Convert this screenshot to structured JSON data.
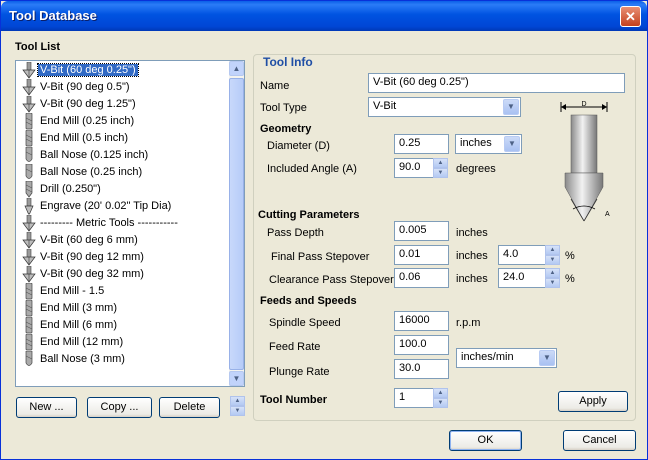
{
  "window": {
    "title": "Tool Database",
    "close_glyph": "✕"
  },
  "tool_list": {
    "label": "Tool List",
    "items": [
      {
        "label": "V-Bit (60 deg 0.25\")",
        "icon": "v-bit-icon",
        "selected": true
      },
      {
        "label": "V-Bit (90 deg 0.5\")",
        "icon": "v-bit-icon"
      },
      {
        "label": "V-Bit (90 deg 1.25\")",
        "icon": "v-bit-icon"
      },
      {
        "label": "End Mill (0.25 inch)",
        "icon": "end-mill-icon"
      },
      {
        "label": "End Mill (0.5 inch)",
        "icon": "end-mill-icon"
      },
      {
        "label": "Ball Nose (0.125 inch)",
        "icon": "ball-nose-icon"
      },
      {
        "label": "Ball Nose (0.25 inch)",
        "icon": "ball-nose-icon"
      },
      {
        "label": "Drill (0.250\")",
        "icon": "drill-icon"
      },
      {
        "label": "Engrave (20' 0.02\" Tip Dia)",
        "icon": "engrave-icon"
      },
      {
        "label": "--------- Metric Tools -----------",
        "icon": "v-bit-icon"
      },
      {
        "label": "V-Bit (60 deg 6 mm)",
        "icon": "v-bit-icon"
      },
      {
        "label": "V-Bit (90 deg 12 mm)",
        "icon": "v-bit-icon"
      },
      {
        "label": "V-Bit (90 deg 32 mm)",
        "icon": "v-bit-icon"
      },
      {
        "label": "End Mill - 1.5",
        "icon": "end-mill-icon"
      },
      {
        "label": "End Mill (3 mm)",
        "icon": "end-mill-icon"
      },
      {
        "label": "End Mill (6 mm)",
        "icon": "end-mill-icon"
      },
      {
        "label": "End Mill (12 mm)",
        "icon": "end-mill-icon"
      },
      {
        "label": "Ball Nose (3 mm)",
        "icon": "ball-nose-icon"
      }
    ],
    "buttons": {
      "new": "New ...",
      "copy": "Copy ...",
      "delete": "Delete"
    }
  },
  "tool_info": {
    "label": "Tool Info",
    "name_label": "Name",
    "name_value": "V-Bit (60 deg 0.25\")",
    "type_label": "Tool Type",
    "type_value": "V-Bit",
    "diagram": {
      "d_label": "D",
      "a_label": "A"
    }
  },
  "geometry": {
    "label": "Geometry",
    "diameter_label": "Diameter (D)",
    "diameter_value": "0.25",
    "diameter_unit": "inches",
    "angle_label": "Included Angle (A)",
    "angle_value": "90.0",
    "angle_unit": "degrees"
  },
  "cutting": {
    "label": "Cutting Parameters",
    "pass_depth_label": "Pass Depth",
    "pass_depth_value": "0.005",
    "pass_depth_unit": "inches",
    "final_label": "Final Pass Stepover",
    "final_value": "0.01",
    "final_unit": "inches",
    "final_pct": "4.0",
    "clear_label": "Clearance Pass Stepover",
    "clear_value": "0.06",
    "clear_unit": "inches",
    "clear_pct": "24.0",
    "pct_sign": "%"
  },
  "feeds": {
    "label": "Feeds and Speeds",
    "spindle_label": "Spindle Speed",
    "spindle_value": "16000",
    "spindle_unit": "r.p.m",
    "feed_label": "Feed Rate",
    "feed_value": "100.0",
    "plunge_label": "Plunge Rate",
    "plunge_value": "30.0",
    "rate_unit": "inches/min"
  },
  "tool_number": {
    "label": "Tool Number",
    "value": "1"
  },
  "actions": {
    "apply": "Apply",
    "ok": "OK",
    "cancel": "Cancel"
  },
  "colors": {
    "title_bar": "#0053e1",
    "selection": "#316ac5",
    "group_title": "#1f4ea5"
  }
}
